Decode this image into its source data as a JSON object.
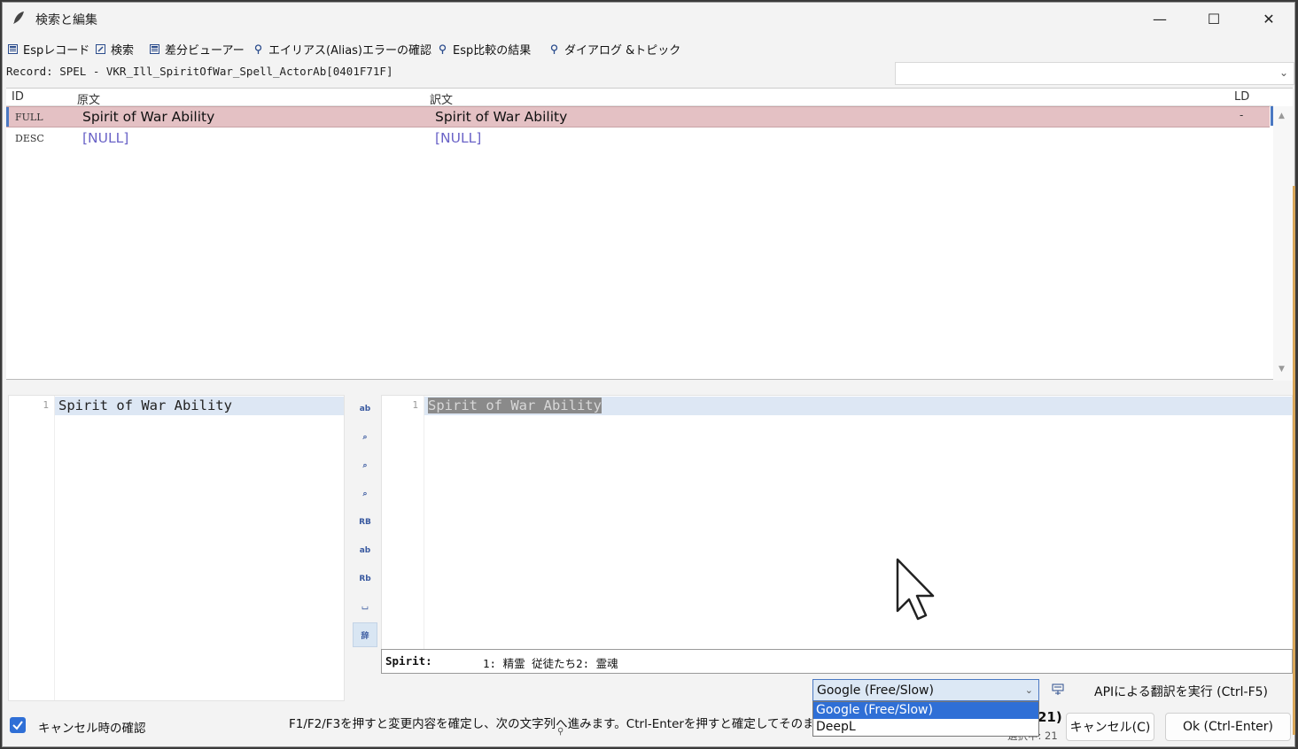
{
  "window": {
    "title": "検索と編集",
    "minimize_glyph": "—",
    "maximize_glyph": "☐",
    "close_glyph": "✕"
  },
  "tabs": [
    {
      "label": "Espレコード",
      "icon": "grid-icon"
    },
    {
      "label": "検索",
      "icon": "edit-icon"
    },
    {
      "label": "差分ビューアー",
      "icon": "grid-icon"
    },
    {
      "label": "エイリアス(Alias)エラーの確認",
      "icon": "pin-icon"
    },
    {
      "label": "Esp比較の結果",
      "icon": "pin-icon"
    },
    {
      "label": "ダイアログ &トピック",
      "icon": "pin-icon"
    }
  ],
  "record": {
    "text": "Record: SPEL - VKR_Ill_SpiritOfWar_Spell_ActorAb[0401F71F]",
    "combo_value": ""
  },
  "grid": {
    "columns": {
      "id": "ID",
      "source": "原文",
      "translation": "訳文",
      "ld": "LD"
    },
    "rows": [
      {
        "id": "FULL",
        "source": "Spirit of War Ability",
        "translation": "Spirit of War Ability",
        "ld": "-",
        "selected": true
      },
      {
        "id": "DESC",
        "source": "[NULL]",
        "translation": "[NULL]",
        "ld": "",
        "selected": false
      }
    ]
  },
  "editor_left": {
    "line_number": "1",
    "text": "Spirit of War Ability"
  },
  "editor_right": {
    "line_number": "1",
    "text": "Spirit of War Ability"
  },
  "toolbar_icons": [
    "ab-replace-icon",
    "search-icon",
    "find-prev-icon",
    "find-next-icon",
    "uppercase-icon",
    "lowercase-icon",
    "capitalize-icon",
    "bracket-icon",
    "dictionary-icon"
  ],
  "toolbar_glyphs": [
    "ab",
    "⌕",
    "⌕",
    "⌕",
    "RB",
    "ab",
    "Rb",
    "⌴",
    "辞"
  ],
  "dictionary": {
    "word": "Spirit:",
    "entries": "1: 精霊 従徒たち2: 霊魂"
  },
  "engine": {
    "selected": "Google (Free/Slow)",
    "options": [
      "Google (Free/Slow)",
      "DeepL"
    ]
  },
  "api_button": {
    "label": "APIによる翻訳を実行 (Ctrl-F5)"
  },
  "status": {
    "confirm_on_cancel_label": "キャンセル時の確認",
    "confirm_on_cancel_checked": true,
    "hint": "F1/F2/F3を押すと変更内容を確定し、次の文字列へ進みます。Ctrl-Enterを押すと確定してそのまま",
    "pin_glyph": "⚲",
    "count_big": "21)",
    "count_small": "選択中: 21"
  },
  "buttons": {
    "cancel": "キャンセル(C)",
    "ok": "Ok (Ctrl-Enter)"
  },
  "colors": {
    "selected_row": "#e4c1c4",
    "accent": "#2f6fd6",
    "null_text": "#6a63c7"
  }
}
